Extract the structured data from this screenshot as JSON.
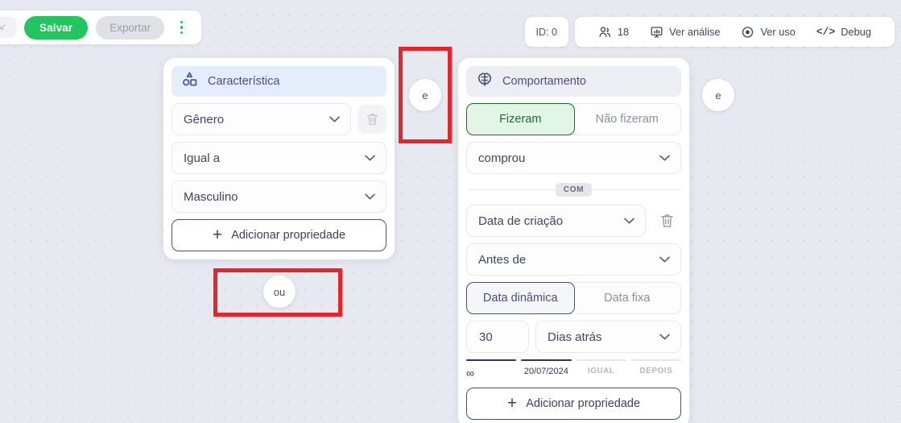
{
  "toolbar": {
    "left": {
      "ghost_icon": "collapse-icon",
      "save_label": "Salvar",
      "export_label": "Exportar",
      "menu_icon": "kebab-menu-icon"
    },
    "right": {
      "id_label": "ID: 0",
      "audience_icon": "people-icon",
      "audience_count": "18",
      "items": [
        {
          "icon": "presentation-chart-icon",
          "label": "Ver análise"
        },
        {
          "icon": "eye-icon",
          "label": "Ver uso"
        },
        {
          "icon": "code-icon",
          "label": "Debug"
        }
      ]
    }
  },
  "cards": {
    "feature": {
      "icon": "shapes-icon",
      "title": "Característica",
      "property": "Gênero",
      "property_delete_icon": "trash-icon",
      "operator": "Igual a",
      "value": "Masculino",
      "add_label": "Adicionar propriedade",
      "add_icon": "plus-icon"
    },
    "behavior": {
      "icon": "brain-icon",
      "title": "Comportamento",
      "did_toggle": {
        "active": "Fizeram",
        "inactive": "Não fizeram"
      },
      "event": "comprou",
      "divider_label": "COM",
      "attribute": "Data de criação",
      "attribute_delete_icon": "trash-icon",
      "comparator": "Antes de",
      "date_toggle": {
        "active": "Data dinâmica",
        "inactive": "Data fixa"
      },
      "amount": "30",
      "unit": "Dias atrás",
      "scale": [
        {
          "label": "∞",
          "active": true,
          "muted": false
        },
        {
          "label": "20/07/2024",
          "active": true,
          "muted": false
        },
        {
          "label": "IGUAL",
          "active": false,
          "muted": true
        },
        {
          "label": "DEPOIS",
          "active": false,
          "muted": true
        }
      ],
      "add_label": "Adicionar propriedade",
      "add_icon": "plus-icon"
    }
  },
  "connectors": {
    "and_left": "e",
    "or": "ou",
    "and_right": "e"
  },
  "colors": {
    "accent_green": "#22c55e",
    "indigo": "#4a4f7a",
    "highlight_red": "#e8242a",
    "canvas": "#e6e9f0"
  }
}
